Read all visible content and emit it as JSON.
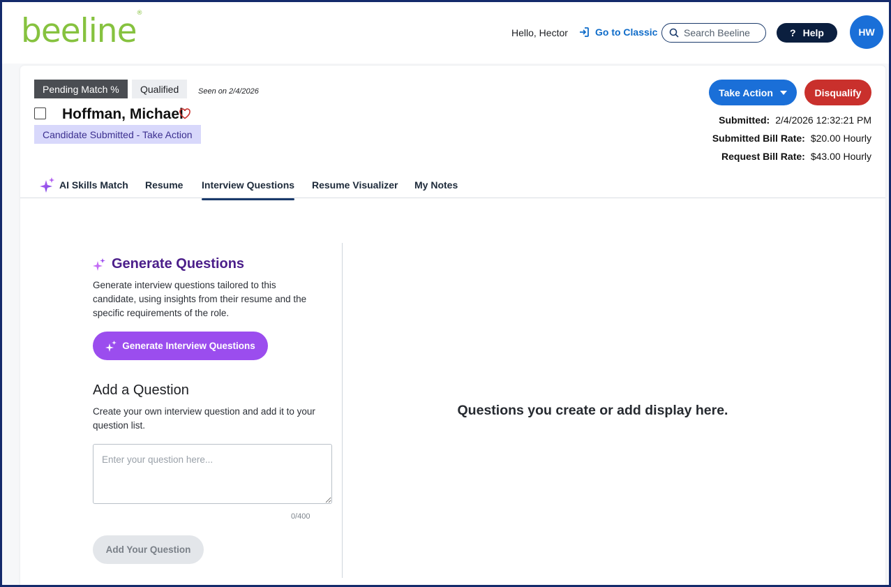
{
  "header": {
    "logo_text": "beeline",
    "logo_mark": "®",
    "greeting": "Hello, Hector",
    "go_classic": "Go to Classic",
    "search_placeholder": "Search Beeline",
    "help": "Help",
    "avatar_initials": "HW",
    "brand_color": "#86c23f"
  },
  "candidate": {
    "tags": [
      "Pending Match %",
      "Qualified"
    ],
    "seen": "Seen on 2/4/2026",
    "name": "Hoffman, Michael",
    "status": "Candidate Submitted - Take Action",
    "actions": {
      "take_action": "Take Action",
      "disqualify": "Disqualify"
    },
    "meta": [
      {
        "label": "Submitted:",
        "value": "2/4/2026 12:32:21 PM"
      },
      {
        "label": "Submitted Bill Rate:",
        "value": "$20.00 Hourly"
      },
      {
        "label": "Request Bill Rate:",
        "value": "$43.00 Hourly"
      }
    ]
  },
  "tabs": [
    {
      "label": "AI Skills Match",
      "icon": "sparkle-icon"
    },
    {
      "label": "Resume"
    },
    {
      "label": "Interview Questions",
      "active": true
    },
    {
      "label": "Resume Visualizer"
    },
    {
      "label": "My Notes"
    }
  ],
  "generate": {
    "title": "Generate Questions",
    "description": "Generate interview questions tailored to this candidate, using insights from their resume and the specific requirements of the role.",
    "button": "Generate Interview Questions"
  },
  "add_question": {
    "title": "Add a Question",
    "description": "Create your own interview question and add it to your question list.",
    "placeholder": "Enter your question here...",
    "counter": "0/400",
    "button": "Add Your Question"
  },
  "empty_state": "Questions you create or add display here.",
  "colors": {
    "primary": "#1a6fd8",
    "danger": "#c9302c",
    "ai_purple": "#9b4dee",
    "ai_title": "#4b1e8a"
  }
}
